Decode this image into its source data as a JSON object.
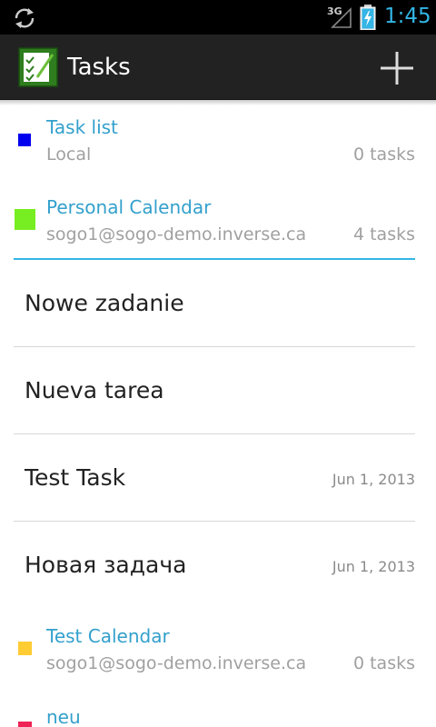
{
  "status_bar": {
    "network_type": "3G",
    "time": "1:45",
    "icons": [
      "sync-icon",
      "signal-icon",
      "battery-charging-icon"
    ],
    "clock_color": "#33b5e5"
  },
  "action_bar": {
    "title": "Tasks",
    "app_icon": "tasks-app-icon",
    "add_icon": "plus-icon"
  },
  "groups": [
    {
      "name": "Task list",
      "account": "Local",
      "count": "0 tasks",
      "color": "#0000ee"
    },
    {
      "name": "Personal Calendar",
      "account": "sogo1@sogo-demo.inverse.ca",
      "count": "4 tasks",
      "color": "#77ee22"
    },
    {
      "name": "Test Calendar",
      "account": "sogo1@sogo-demo.inverse.ca",
      "count": "0 tasks",
      "color": "#ffcc33"
    },
    {
      "name": "neu",
      "account": "",
      "count": "",
      "color": "#ee2255"
    }
  ],
  "tasks": [
    {
      "title": "Nowe zadanie",
      "due": ""
    },
    {
      "title": "Nueva tarea",
      "due": ""
    },
    {
      "title": "Test Task",
      "due": "Jun 1, 2013"
    },
    {
      "title": "Новая задача",
      "due": "Jun 1, 2013"
    }
  ],
  "accent_color": "#33b5e5"
}
